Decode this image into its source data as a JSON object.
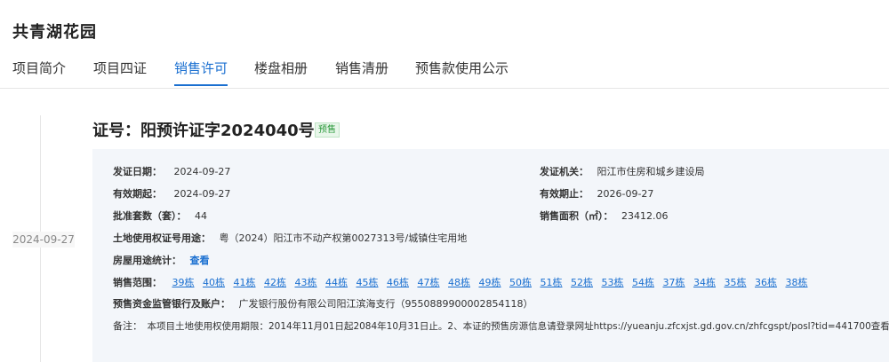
{
  "project": {
    "name": "共青湖花园"
  },
  "tabs": [
    {
      "label": "项目简介"
    },
    {
      "label": "项目四证"
    },
    {
      "label": "销售许可"
    },
    {
      "label": "楼盘相册"
    },
    {
      "label": "销售清册"
    },
    {
      "label": "预售款使用公示"
    }
  ],
  "timeline": {
    "date": "2024-09-27"
  },
  "permit": {
    "title": "证号：阳预许证字2024040号",
    "badge": "预售",
    "issue_date_label": "发证日期：",
    "issue_date": "2024-09-27",
    "issuer_label": "发证机关：",
    "issuer": "阳江市住房和城乡建设局",
    "valid_from_label": "有效期起：",
    "valid_from": "2024-09-27",
    "valid_to_label": "有效期止：",
    "valid_to": "2026-09-27",
    "units_label": "批准套数（套）：",
    "units": "44",
    "area_label": "销售面积（㎡）：",
    "area": "23412.06",
    "land_cert_label": "土地使用权证号用途：",
    "land_cert": "粤（2024）阳江市不动产权第0027313号/城镇住宅用地",
    "housing_stats_label": "房屋用途统计：",
    "housing_stats_link": "查看",
    "scope_label": "销售范围：",
    "buildings": [
      "39栋",
      "40栋",
      "41栋",
      "42栋",
      "43栋",
      "44栋",
      "45栋",
      "46栋",
      "47栋",
      "48栋",
      "49栋",
      "50栋",
      "51栋",
      "52栋",
      "53栋",
      "54栋",
      "37栋",
      "34栋",
      "35栋",
      "36栋",
      "38栋"
    ],
    "bank_label": "预售资金监管银行及账户：",
    "bank": "广发银行股份有限公司阳江滨海支行（9550889900002854118）",
    "remark_label": "备注：",
    "remark": "本项目土地使用权使用期限：2014年11月01日起2084年10月31日止。2、本证的预售房源信息请登录网址https://yueanju.zfcxjst.gd.gov.cn/zhfcgspt/posl?tid=441700查看。"
  }
}
